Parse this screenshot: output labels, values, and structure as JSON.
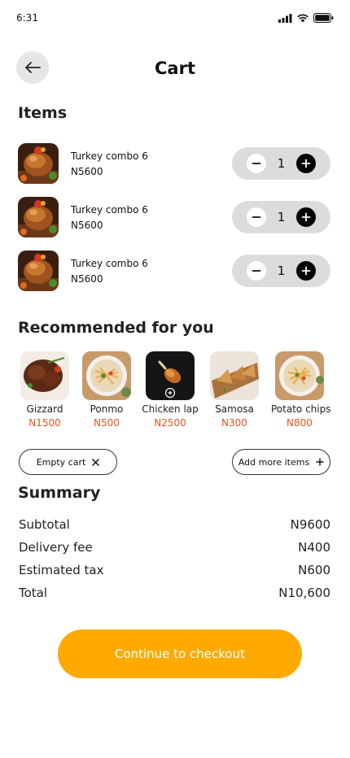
{
  "status": {
    "time": "6:31"
  },
  "header": {
    "title": "Cart"
  },
  "items_heading": "Items",
  "cart_items": [
    {
      "name": "Turkey combo 6",
      "price": "N5600",
      "qty": "1"
    },
    {
      "name": "Turkey combo 6",
      "price": "N5600",
      "qty": "1"
    },
    {
      "name": "Turkey combo 6",
      "price": "N5600",
      "qty": "1"
    }
  ],
  "recommended_heading": "Recommended for you",
  "recommended": [
    {
      "name": "Gizzard",
      "price": "N1500",
      "icon": "gizzard-image"
    },
    {
      "name": "Ponmo",
      "price": "N500",
      "icon": "ponmo-image"
    },
    {
      "name": "Chicken lap",
      "price": "N2500",
      "icon": "chicken-lap-image"
    },
    {
      "name": "Samosa",
      "price": "N300",
      "icon": "samosa-image"
    },
    {
      "name": "Potato chips",
      "price": "N800",
      "icon": "potato-chips-image"
    }
  ],
  "actions": {
    "empty_cart": "Empty cart",
    "add_more": "Add more items"
  },
  "summary_heading": "Summary",
  "summary": {
    "subtotal_label": "Subtotal",
    "subtotal": "N9600",
    "delivery_label": "Delivery fee",
    "delivery": "N400",
    "tax_label": "Estimated tax",
    "tax": "N600",
    "total_label": "Total",
    "total": "N10,600"
  },
  "checkout_label": "Continue to checkout",
  "colors": {
    "accent": "#FFAA00",
    "price_accent": "#E8541C"
  }
}
